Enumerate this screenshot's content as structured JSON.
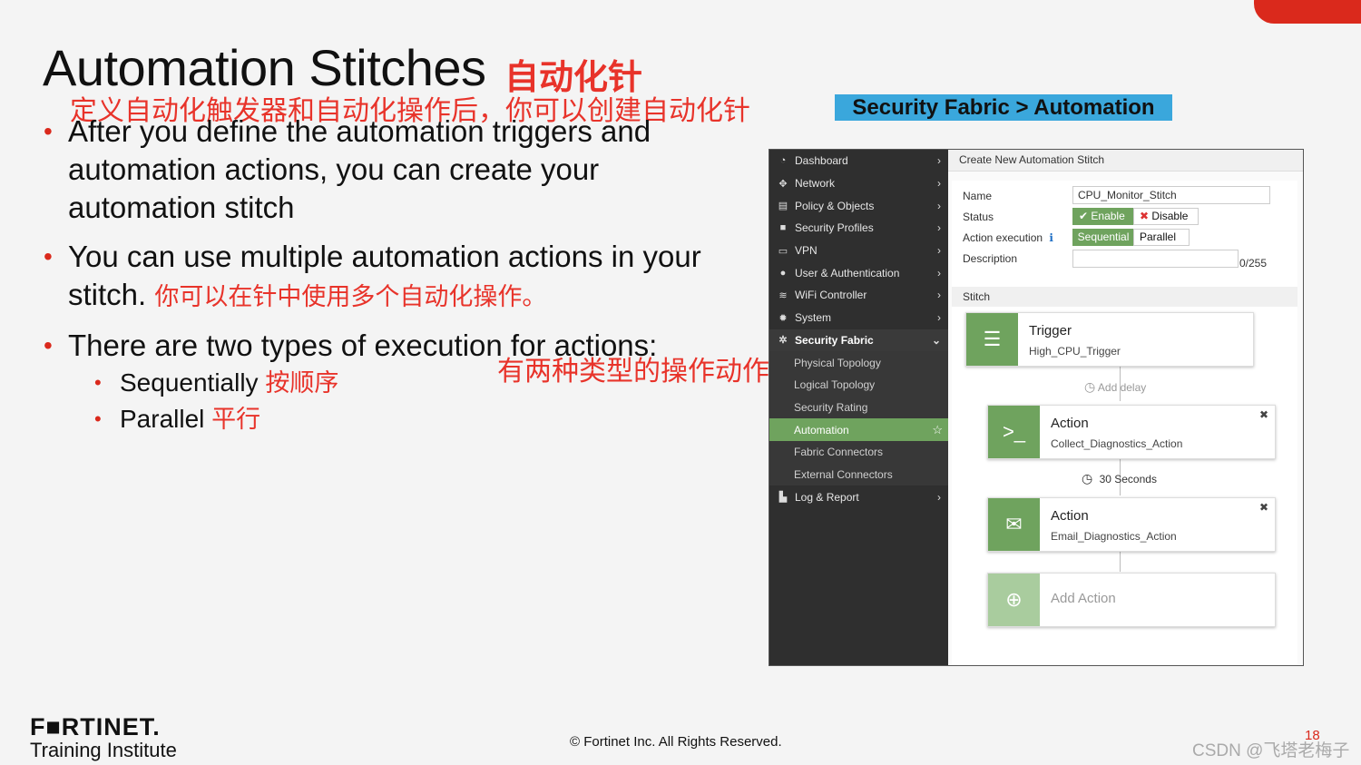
{
  "slide": {
    "title": "Automation Stitches",
    "title_cn": "自动化针",
    "annotation_top": "定义自动化触发器和自动化操作后，你可以创建自动化针",
    "bullets": [
      "After you define the automation triggers and automation actions, you can create your automation stitch",
      "You can use multiple automation actions in your stitch.",
      "There are two types of execution for actions:"
    ],
    "bullet2_cn": "你可以在针中使用多个自动化操作。",
    "annotation_mid": "有两种类型的操作动作：",
    "sub_bullets": [
      {
        "label": "Sequentially",
        "cn": "按顺序"
      },
      {
        "label": "Parallel",
        "cn": "平行"
      }
    ],
    "banner": "Security Fabric > Automation",
    "footer": {
      "logo": "F■RTINET.",
      "logo_sub": "Training Institute",
      "copyright": "© Fortinet Inc. All Rights Reserved.",
      "page": "18",
      "watermark": "CSDN @飞塔老梅子"
    }
  },
  "colors": {
    "accent": "#da291c",
    "annotation": "#e8332a",
    "banner": "#3aa7dc",
    "green": "#6fa35e",
    "nav": "#2f2f2f"
  },
  "nav": {
    "items": [
      {
        "label": "Dashboard",
        "icon": "dashboard-icon"
      },
      {
        "label": "Network",
        "icon": "network-icon"
      },
      {
        "label": "Policy & Objects",
        "icon": "policy-icon"
      },
      {
        "label": "Security Profiles",
        "icon": "lock-icon"
      },
      {
        "label": "VPN",
        "icon": "laptop-icon"
      },
      {
        "label": "User & Authentication",
        "icon": "user-icon"
      },
      {
        "label": "WiFi Controller",
        "icon": "wifi-icon"
      },
      {
        "label": "System",
        "icon": "gear-icon"
      },
      {
        "label": "Security Fabric",
        "icon": "fabric-icon"
      }
    ],
    "fabric_sub": [
      "Physical Topology",
      "Logical Topology",
      "Security Rating",
      "Automation",
      "Fabric Connectors",
      "External Connectors"
    ],
    "log": {
      "label": "Log & Report",
      "icon": "chart-icon"
    }
  },
  "form": {
    "header": "Create New Automation Stitch",
    "name_label": "Name",
    "name_value": "CPU_Monitor_Stitch",
    "status_label": "Status",
    "enable": "Enable",
    "disable": "Disable",
    "exec_label": "Action execution",
    "sequential": "Sequential",
    "parallel": "Parallel",
    "desc_label": "Description",
    "desc_counter": "0/255",
    "stitch_label": "Stitch"
  },
  "stitch": {
    "trigger": {
      "title": "Trigger",
      "sub": "High_CPU_Trigger"
    },
    "add_delay": "Add delay",
    "action1": {
      "title": "Action",
      "sub": "Collect_Diagnostics_Action"
    },
    "delay": "30 Seconds",
    "action2": {
      "title": "Action",
      "sub": "Email_Diagnostics_Action"
    },
    "add_action": "Add Action"
  }
}
